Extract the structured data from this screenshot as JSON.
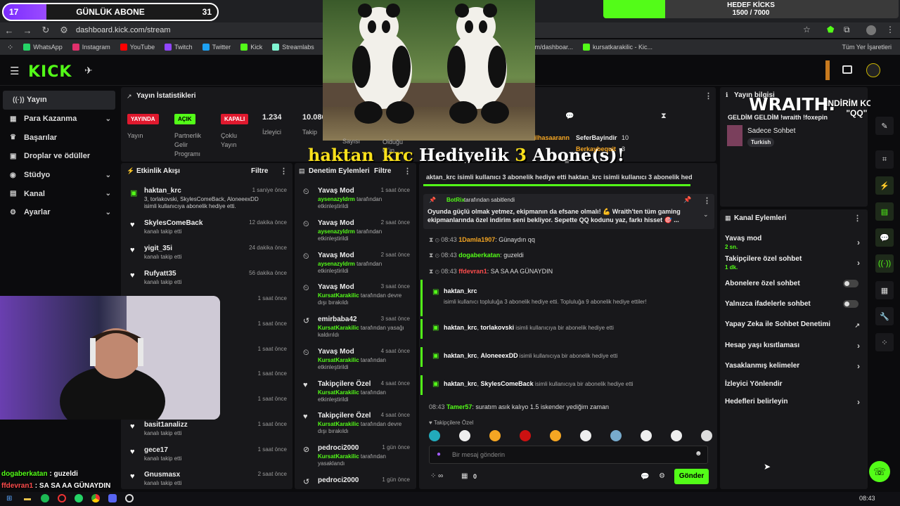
{
  "overlay": {
    "sub_count": "17",
    "sub_label": "GÜNLÜK ABONE",
    "sub_goal": "31",
    "kick_goal_title": "HEDEF KİCKS",
    "kick_goal_value": "1500 / 7000",
    "kick_goal_progress": 0.21,
    "gift_user": "haktan_krc",
    "gift_text1": " Hediyelik ",
    "gift_number": "3",
    "gift_text2": " Abone(s)!",
    "brand": "WRAITH.",
    "discount": "İNDİRİM KODU:",
    "code": "\"QQ\"",
    "chat_ov": [
      {
        "user": "dogaberkatan",
        "text": " : guzeldi"
      },
      {
        "user": "ffdevran1",
        "text": " : SA SA AA GÜNAYDIN"
      }
    ]
  },
  "browser": {
    "url": "dashboard.kick.com/stream",
    "bookmarks": [
      "WhatsApp",
      "Instagram",
      "YouTube",
      "Twitch",
      "Twitter",
      "Kick",
      "Streamlabs",
      "Mail",
      "Oyna - Canlı 1...",
      "Kürşat Karaklıç (@k...",
      "blerp.com/dashboar...",
      "kursatkarakilic - Kic..."
    ],
    "all_bookmarks": "Tüm Yer İşaretleri"
  },
  "sidebar": {
    "items": [
      {
        "label": "Yayın",
        "icon": "((·))"
      },
      {
        "label": "Para Kazanma",
        "icon": "▦"
      },
      {
        "label": "Başarılar",
        "icon": "♛"
      },
      {
        "label": "Droplar ve ödüller",
        "icon": "▣"
      },
      {
        "label": "Stüdyo",
        "icon": "◉"
      },
      {
        "label": "Kanal",
        "icon": "▤"
      },
      {
        "label": "Ayarlar",
        "icon": "⚙"
      }
    ]
  },
  "stats": {
    "title": "Yayın İstatistikleri",
    "stream_badge": "YAYINDA",
    "stream_label": "Yayın",
    "partner_badge": "AÇIK",
    "partner_label": "Partnerlik Gelir Programı",
    "slow_badge": "KAPALI",
    "slow_label": "Çoklu Yayın",
    "viewers": "1.234",
    "viewers_label": "İzleyici",
    "followers": "10.086",
    "followers_label": "Takip",
    "sayisi": "Sayısı",
    "oldugu": "Olduğu Gün"
  },
  "events": {
    "title": "Etkinlik Akışı",
    "filter": "Filtre",
    "items": [
      {
        "name": "haktan_krc",
        "time": "1 saniye önce",
        "desc": "3, torlakovski, SkylesComeBack, AloneeexDD isimli kullanıcıya abonelik hediye etti."
      },
      {
        "name": "SkylesComeBack",
        "time": "12 dakika önce",
        "desc": "kanalı takip etti"
      },
      {
        "name": "yigit_35i",
        "time": "24 dakika önce",
        "desc": "kanalı takip etti"
      },
      {
        "name": "Rufyatt35",
        "time": "56 dakika önce",
        "desc": "kanalı takip etti"
      },
      {
        "name": "",
        "time": "1 saat önce",
        "desc": ""
      },
      {
        "name": "",
        "time": "1 saat önce",
        "desc": ""
      },
      {
        "name": "",
        "time": "1 saat önce",
        "desc": ""
      },
      {
        "name": "",
        "time": "1 saat önce",
        "desc": ""
      },
      {
        "name": "",
        "time": "1 saat önce",
        "desc": ""
      },
      {
        "name": "basit1analizz",
        "time": "1 saat önce",
        "desc": "kanalı takip etti"
      },
      {
        "name": "gece17",
        "time": "1 saat önce",
        "desc": "kanalı takip etti"
      },
      {
        "name": "Gnusmasx",
        "time": "2 saat önce",
        "desc": "kanalı takip etti"
      }
    ]
  },
  "mod": {
    "title": "Denetim Eylemleri",
    "filter": "Filtre",
    "items": [
      {
        "name": "Yavaş Mod",
        "time": "1 saat önce",
        "user": "aysenazyldrm",
        "rest": " tarafından etkinleştirildi",
        "ic": "⏲"
      },
      {
        "name": "Yavaş Mod",
        "time": "2 saat önce",
        "user": "aysenazyldrm",
        "rest": " tarafından etkinleştirildi",
        "ic": "⏲"
      },
      {
        "name": "Yavaş Mod",
        "time": "2 saat önce",
        "user": "aysenazyldrm",
        "rest": " tarafından etkinleştirildi",
        "ic": "⏲"
      },
      {
        "name": "Yavaş Mod",
        "time": "3 saat önce",
        "user": "KursatKarakilic",
        "rest": " tarafından devre dışı bırakıldı",
        "ic": "⏲"
      },
      {
        "name": "emirbaba42",
        "time": "3 saat önce",
        "user": "KursatKarakilic",
        "rest": " tarafından yasağı kaldırıldı",
        "ic": "↺"
      },
      {
        "name": "Yavaş Mod",
        "time": "4 saat önce",
        "user": "KursatKarakilic",
        "rest": " tarafından etkinleştirildi",
        "ic": "⏲"
      },
      {
        "name": "Takipçilere Özel",
        "time": "4 saat önce",
        "user": "KursatKarakilic",
        "rest": " tarafından etkinleştirildi",
        "ic": "♥"
      },
      {
        "name": "Takipçilere Özel",
        "time": "4 saat önce",
        "user": "KursatKarakilic",
        "rest": " tarafından devre dışı bırakıldı",
        "ic": "♥"
      },
      {
        "name": "pedroci2000",
        "time": "1 gün önce",
        "user": "KursatKarakilic",
        "rest": " tarafından yasaklandı",
        "ic": "⊘"
      },
      {
        "name": "pedroci2000",
        "time": "1 gün önce",
        "user": "",
        "rest": "",
        "ic": "↺"
      }
    ]
  },
  "chat": {
    "top_users": [
      {
        "name": "ilhasaarann",
        "col": "#f5a623"
      },
      {
        "name": "SeferBayindir",
        "col": "#eeeeee",
        "n": "10"
      },
      {
        "name": "Berkaybequit",
        "col": "#f5a623",
        "n": "3"
      }
    ],
    "ticker": "aktan_krc isimli kullanıcı 3 abonelik hediye etti   haktan_krc isimli kullanıcı 3 abonelik hed",
    "pinned_by": "BotRix",
    "pinned_label": " tarafından sabitlendi",
    "pinned_text": "Oyunda güçlü olmak yetmez, ekipmanın da efsane olmalı! 💪 Wraith'ten tüm gaming ekipmanlarında özel indirim seni bekliyor. Sepette QQ kodunu yaz, farkı hisset 🎯 ...",
    "messages": [
      {
        "time": "08:43",
        "user": "1Damla1907",
        "col": "#f5a623",
        "text": ": Günaydın qq"
      },
      {
        "time": "08:43",
        "user": "dogaberkatan",
        "col": "#53fc18",
        "text": ": guzeldi"
      },
      {
        "time": "08:43",
        "user": "ffdevran1",
        "col": "#ff4d4d",
        "text": ": SA SA AA GÜNAYDIN"
      }
    ],
    "gifts": [
      {
        "user": "haktan_krc",
        "text": "",
        "sub": "isimli kullanıcı topluluğa 3 abonelik hediye etti. Topluluğa 9 abonelik hediye ettiler!"
      },
      {
        "user": "haktan_krc",
        "text": "torlakovski",
        "sub": " isimli kullanıcıya bir abonelik hediye etti"
      },
      {
        "user": "haktan_krc",
        "text": "AloneeexDD",
        "sub": " isimli kullanıcıya bir abonelik hediye etti"
      },
      {
        "user": "haktan_krc",
        "text": "SkylesComeBack",
        "sub": " isimli kullanıcıya bir abonelik hediye etti"
      }
    ],
    "last": {
      "time": "08:43",
      "user": "Tamer57",
      "text": ": suratım asık kalıyo 1.5 iskender yediğim zaman"
    },
    "followers_only": "Takipçilere Özel",
    "placeholder": "Bir mesaj gönderin",
    "count": "0",
    "send": "Gönder"
  },
  "info": {
    "title": "Yayın bilgisi",
    "stream_title": "GELDİM GELDİM !wraith !foxepin",
    "category": "Sadece Sohbet",
    "tag": "Turkish"
  },
  "actions": {
    "title": "Kanal Eylemleri",
    "items": [
      {
        "label": "Yavaş mod",
        "sub": "2 sn.",
        "kind": "arrow"
      },
      {
        "label": "Takipçilere özel sohbet",
        "sub": "1 dk.",
        "kind": "arrow"
      },
      {
        "label": "Abonelere özel sohbet",
        "sub": "",
        "kind": "toggle"
      },
      {
        "label": "Yalnızca ifadelerle sohbet",
        "sub": "",
        "kind": "toggle"
      },
      {
        "label": "Yapay Zeka ile Sohbet Denetimi",
        "sub": "",
        "kind": "ext"
      },
      {
        "label": "Hesap yaşı kısıtlaması",
        "sub": "",
        "kind": "arrow"
      },
      {
        "label": "Yasaklanmış kelimeler",
        "sub": "",
        "kind": "arrow"
      },
      {
        "label": "İzleyici Yönlendir",
        "sub": "",
        "kind": "none"
      },
      {
        "label": "Hedefleri belirleyin",
        "sub": "",
        "kind": "arrow"
      }
    ]
  },
  "taskbar": {
    "clock": "08:43"
  }
}
